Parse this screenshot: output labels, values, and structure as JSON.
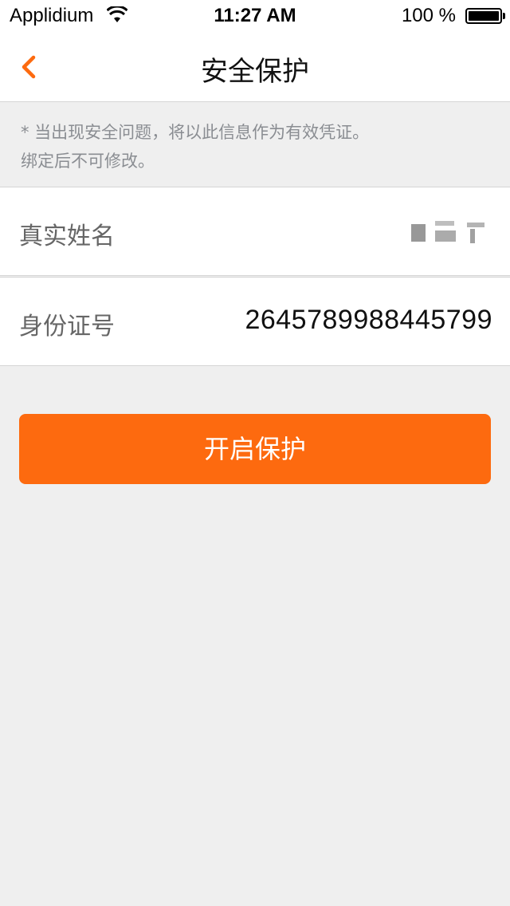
{
  "status_bar": {
    "carrier": "Applidium",
    "time": "11:27 AM",
    "battery": "100 %"
  },
  "nav": {
    "title": "安全保护",
    "back_icon": "chevron-left-icon"
  },
  "notice": {
    "line1": "* 当出现安全问题，将以此信息作为有效凭证。",
    "line2": "绑定后不可修改。"
  },
  "form": {
    "name_label": "真实姓名",
    "id_label": "身份证号",
    "id_value": "2645789988445799"
  },
  "actions": {
    "enable_label": "开启保护"
  },
  "colors": {
    "accent": "#fd6a0f",
    "background": "#efefef",
    "muted_text": "#8a8d92"
  }
}
